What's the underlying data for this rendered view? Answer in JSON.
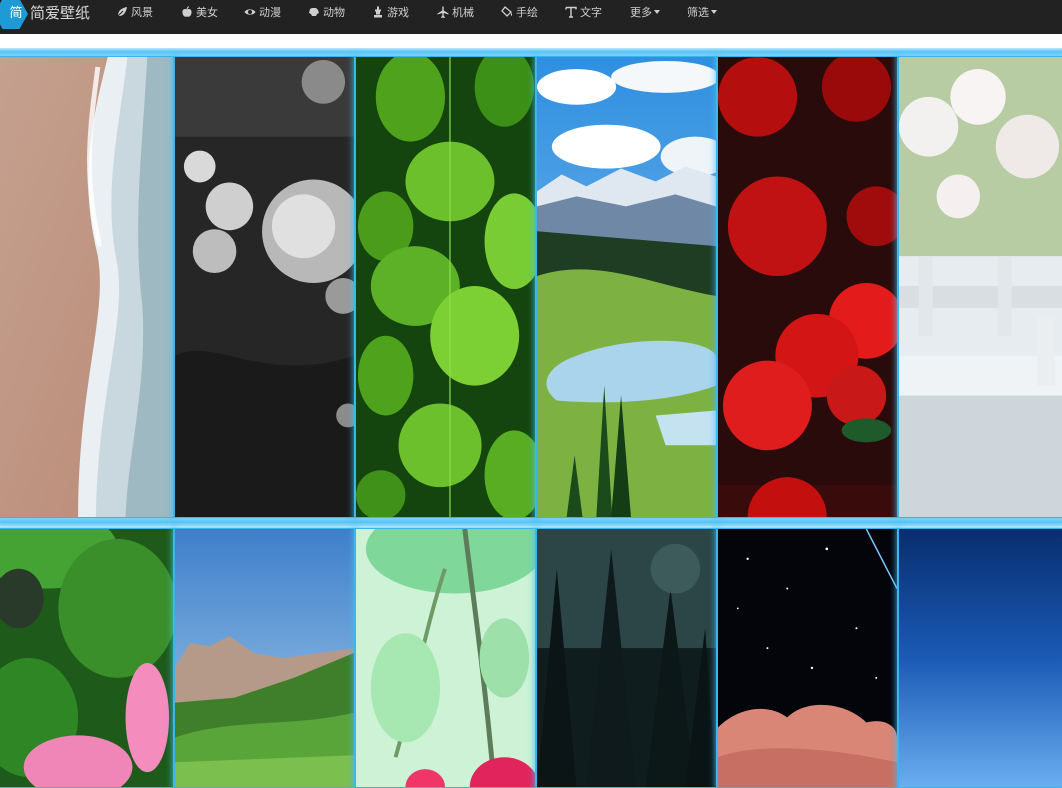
{
  "brand": {
    "logo_char": "简",
    "name": "简爱壁纸"
  },
  "nav": {
    "items": [
      {
        "label": "风景",
        "icon": "leaf-icon"
      },
      {
        "label": "美女",
        "icon": "apple-icon"
      },
      {
        "label": "动漫",
        "icon": "eye-icon"
      },
      {
        "label": "动物",
        "icon": "dog-icon"
      },
      {
        "label": "游戏",
        "icon": "chess-icon"
      },
      {
        "label": "机械",
        "icon": "plane-icon"
      },
      {
        "label": "手绘",
        "icon": "paint-bucket-icon"
      },
      {
        "label": "文字",
        "icon": "text-icon"
      }
    ],
    "more_label": "更多",
    "filter_label": "筛选"
  },
  "gallery": {
    "row1": [
      {
        "subject": "beach-waves",
        "palette": [
          "#c8a493",
          "#eef4f7"
        ]
      },
      {
        "subject": "grayscale-flowers",
        "palette": [
          "#2b2b2b",
          "#d0d0d0"
        ]
      },
      {
        "subject": "green-nettle-leaves",
        "palette": [
          "#1f6a14",
          "#7ccc2e"
        ]
      },
      {
        "subject": "mountain-lake",
        "palette": [
          "#4aa6e8",
          "#6fae3a"
        ]
      },
      {
        "subject": "red-roses",
        "palette": [
          "#7a0a0a",
          "#e11a1a"
        ]
      },
      {
        "subject": "blossom-balustrade",
        "palette": [
          "#e6eaee",
          "#b9c9a6"
        ]
      }
    ],
    "row2": [
      {
        "subject": "pink-flower-leaves",
        "palette": [
          "#2e8e24",
          "#f07fb3"
        ]
      },
      {
        "subject": "dolomites-meadow",
        "palette": [
          "#5b9bd8",
          "#3d8a2c"
        ]
      },
      {
        "subject": "green-twig-berry",
        "palette": [
          "#c9f1d2",
          "#e0245a"
        ]
      },
      {
        "subject": "dark-forest",
        "palette": [
          "#0f1c1d",
          "#3f5656"
        ]
      },
      {
        "subject": "starry-night-cloud",
        "palette": [
          "#04060b",
          "#d98a7a"
        ]
      },
      {
        "subject": "blue-sky-gradient",
        "palette": [
          "#0a3f8f",
          "#5da7ea"
        ]
      }
    ]
  }
}
